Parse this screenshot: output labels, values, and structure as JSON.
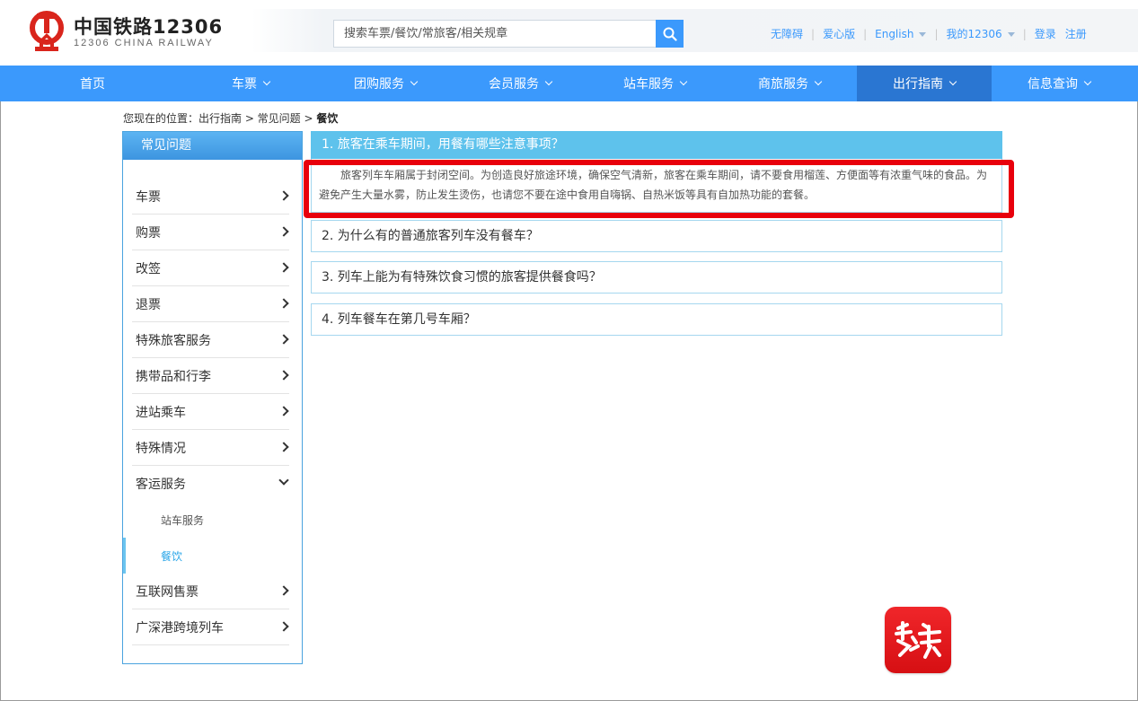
{
  "header": {
    "logo_cn": "中国铁路12306",
    "logo_en": "12306 CHINA RAILWAY",
    "search_placeholder": "搜索车票/餐饮/常旅客/相关规章",
    "links": {
      "accessibility": "无障碍",
      "care": "爱心版",
      "english": "English",
      "my12306": "我的12306",
      "login": "登录",
      "register": "注册"
    }
  },
  "nav": {
    "items": [
      "首页",
      "车票",
      "团购服务",
      "会员服务",
      "站车服务",
      "商旅服务",
      "出行指南",
      "信息查询"
    ],
    "active": "出行指南"
  },
  "breadcrumb": {
    "prefix": "您现在的位置：出行指南 > 常见问题 > ",
    "current": "餐饮"
  },
  "sidebar": {
    "title": "常见问题",
    "items": [
      "车票",
      "购票",
      "改签",
      "退票",
      "特殊旅客服务",
      "携带品和行李",
      "进站乘车",
      "特殊情况",
      "客运服务"
    ],
    "sub_items": [
      "站车服务",
      "餐饮"
    ],
    "items_after": [
      "互联网售票",
      "广深港跨境列车"
    ]
  },
  "faq": {
    "q1": "1. 旅客在乘车期间，用餐有哪些注意事项？",
    "a1": "旅客列车车厢属于封闭空间。为创造良好旅途环境，确保空气清新，旅客在乘车期间，请不要食用榴莲、方便面等有浓重气味的食品。为避免产生大量水雾，防止发生烫伤，也请您不要在途中食用自嗨锅、自热米饭等具有自加热功能的套餐。",
    "q2": "2. 为什么有的普通旅客列车没有餐车？",
    "q3": "3. 列车上能为有特殊饮食习惯的旅客提供餐食吗？",
    "q4": "4. 列车餐车在第几号车厢？"
  },
  "colors": {
    "nav_blue": "#3b99fc",
    "nav_active": "#2a76d2",
    "faq_head": "#5ec2ec",
    "highlight": "#e8000c"
  }
}
